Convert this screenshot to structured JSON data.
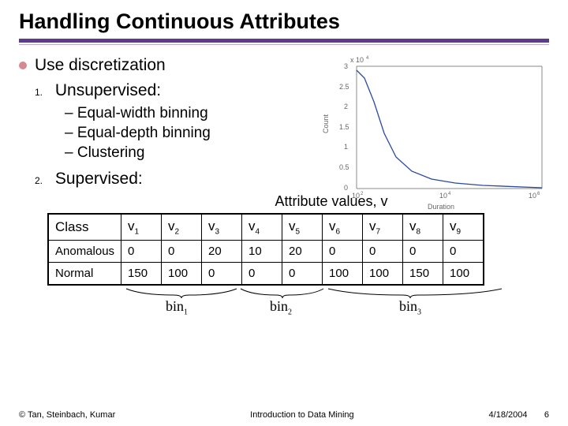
{
  "title": "Handling Continuous Attributes",
  "lead": "Use discretization",
  "items": {
    "n1": "1.",
    "n2": "2.",
    "i1": "Unsupervised:",
    "i2": "Supervised:",
    "sub1": "–   Equal-width binning",
    "sub2": "–   Equal-depth binning",
    "sub3": "–   Clustering"
  },
  "attr_caption": "Attribute values, v",
  "table": {
    "class_header": "Class",
    "v_headers": [
      "v",
      "v",
      "v",
      "v",
      "v",
      "v",
      "v",
      "v",
      "v"
    ],
    "v_subs": [
      "1",
      "2",
      "3",
      "4",
      "5",
      "6",
      "7",
      "8",
      "9"
    ],
    "rows": [
      {
        "label": "Anomalous",
        "cells": [
          "0",
          "0",
          "20",
          "10",
          "20",
          "0",
          "0",
          "0",
          "0"
        ]
      },
      {
        "label": "Normal",
        "cells": [
          "150",
          "100",
          "0",
          "0",
          "0",
          "100",
          "100",
          "150",
          "100"
        ]
      }
    ]
  },
  "bins": {
    "b1": "bin",
    "s1": "1",
    "b2": "bin",
    "s2": "2",
    "b3": "bin",
    "s3": "3"
  },
  "footer": {
    "left": "© Tan, Steinbach, Kumar",
    "center": "Introduction to Data Mining",
    "right_date": "4/18/2004",
    "right_page": "6"
  },
  "chart_data": {
    "type": "line",
    "title": "",
    "xlabel": "Duration",
    "ylabel": "Count",
    "x_scale": "log",
    "xlim": [
      100,
      1000000
    ],
    "ylim": [
      0,
      3
    ],
    "y_multiplier_label": "x 10^4",
    "x": [
      100,
      300,
      600,
      1000,
      3000,
      10000,
      30000,
      100000,
      300000,
      1000000
    ],
    "values": [
      2.9,
      2.4,
      1.2,
      0.6,
      0.3,
      0.15,
      0.08,
      0.04,
      0.02,
      0.0
    ],
    "notes": "y values are in units of 10^4"
  }
}
